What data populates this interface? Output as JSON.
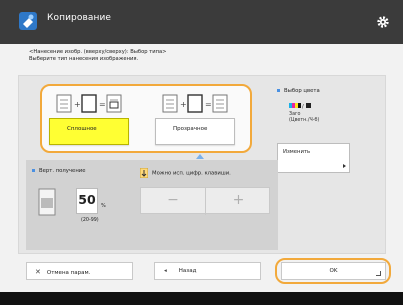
{
  "title": "Копирование",
  "instruction": {
    "line1": "<Нанесение изобр. (вверху/сверху): Выбор типа>",
    "line2": "Выберите тип нанесения изображения."
  },
  "options": [
    {
      "label": "Сплошное",
      "selected": true
    },
    {
      "label": "Прозрачное",
      "selected": false
    }
  ],
  "color_select": {
    "label": "Выбор цвета",
    "description_line1": "Заго",
    "description_line2": "(Цветн./Ч-б)",
    "change_button": "Изменить"
  },
  "vertical_adjust": {
    "label": "Верт. получение",
    "value": "50",
    "unit": "%",
    "range": "(20-99)"
  },
  "text_region": {
    "label": "Можно исп. цифр. клавиши."
  },
  "stepper": {
    "minus": "−",
    "plus": "+"
  },
  "buttons": {
    "cancel": "Отмена парам.",
    "back": "Назад",
    "ok": "OK"
  },
  "colors": {
    "accent": "#f2a93b",
    "selected": "#ffff33",
    "titlebar": "#3b3b3b"
  },
  "icons": [
    "copy-app-icon",
    "gear-icon",
    "close-icon",
    "left-arrow-icon",
    "page-icon",
    "overlay-arrow-icon",
    "pointer-icon"
  ]
}
